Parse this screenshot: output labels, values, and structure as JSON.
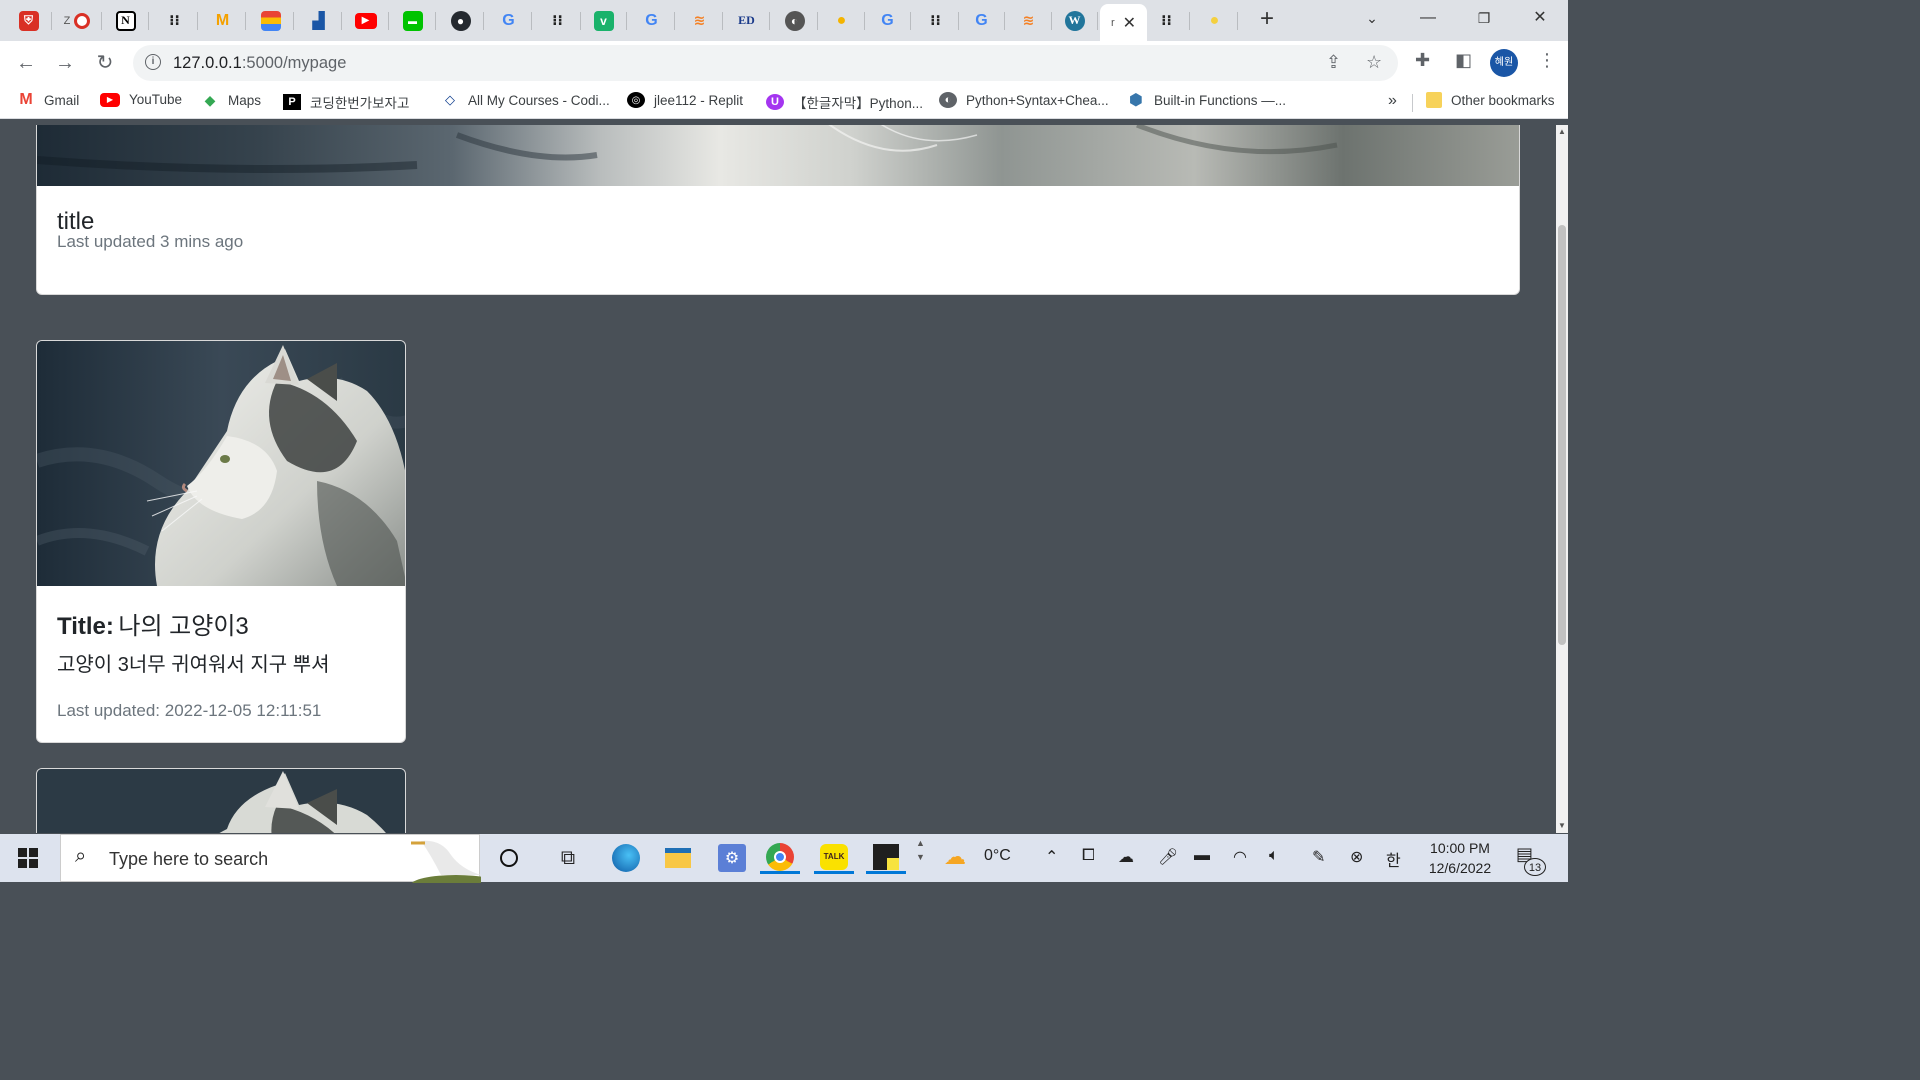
{
  "browser": {
    "active_tab_char": "r",
    "address": {
      "host": "127.0.0.1",
      "path": ":5000/mypage"
    },
    "profile_label": "혜원",
    "bookmarks": [
      {
        "label": "Gmail",
        "icon": "gmail-icon",
        "color": "#ea4335"
      },
      {
        "label": "YouTube",
        "icon": "youtube-icon",
        "color": "#ff0000"
      },
      {
        "label": "Maps",
        "icon": "maps-icon",
        "color": "#34a853"
      },
      {
        "label": "코딩한번가보자고",
        "icon": "p-icon",
        "color": "#000000"
      },
      {
        "label": "All My Courses - Codi...",
        "icon": "diamond-icon",
        "color": "#0b3b8c"
      },
      {
        "label": "jlee112 - Replit",
        "icon": "replit-icon",
        "color": "#000000"
      },
      {
        "label": "【한글자막】Python...",
        "icon": "udemy-icon",
        "color": "#a435f0"
      },
      {
        "label": "Python+Syntax+Chea...",
        "icon": "globe-icon",
        "color": "#5f6368"
      },
      {
        "label": "Built-in Functions —...",
        "icon": "python-icon",
        "color": "#3776ab"
      }
    ],
    "bookmarks_overflow": "»",
    "other_bookmarks": "Other bookmarks"
  },
  "page": {
    "top_card": {
      "title": "title",
      "updated": "Last updated 3 mins ago"
    },
    "posts": [
      {
        "title_label": "Title:",
        "title": "나의 고양이3",
        "text": "고양이 3너무 귀여워서 지구 뿌셔",
        "updated": "Last updated: 2022-12-05 12:11:51"
      }
    ]
  },
  "taskbar": {
    "search_placeholder": "Type here to search",
    "weather": "0°C",
    "ime": "한",
    "time": "10:00 PM",
    "date": "12/6/2022",
    "notifications": "13"
  },
  "colors": {
    "page_bg": "#495057",
    "tab_strip": "#dee1e6",
    "accent": "#0078d7"
  }
}
